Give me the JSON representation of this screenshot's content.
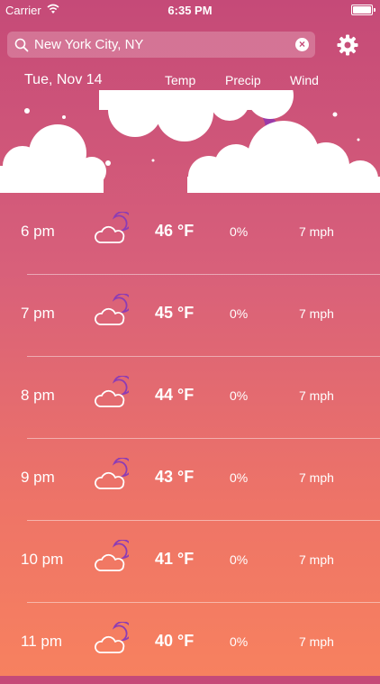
{
  "status_bar": {
    "carrier": "Carrier",
    "time": "6:35 PM"
  },
  "search": {
    "value": "New York City, NY",
    "clear_icon": "clear-icon"
  },
  "settings_icon": "gear-icon",
  "header": {
    "date": "Tue, Nov 14",
    "temp_label": "Temp",
    "precip_label": "Precip",
    "wind_label": "Wind"
  },
  "colors": {
    "gradient_top": "#c54a78",
    "gradient_bottom": "#f7815f",
    "moon": "#9b3aa8",
    "cloud": "#ffffff"
  },
  "hours": [
    {
      "time": "6 pm",
      "icon": "cloudy-night-icon",
      "temp": "46 °F",
      "precip": "0%",
      "wind": "7 mph"
    },
    {
      "time": "7 pm",
      "icon": "cloudy-night-icon",
      "temp": "45 °F",
      "precip": "0%",
      "wind": "7 mph"
    },
    {
      "time": "8 pm",
      "icon": "cloudy-night-icon",
      "temp": "44 °F",
      "precip": "0%",
      "wind": "7 mph"
    },
    {
      "time": "9 pm",
      "icon": "cloudy-night-icon",
      "temp": "43 °F",
      "precip": "0%",
      "wind": "7 mph"
    },
    {
      "time": "10 pm",
      "icon": "cloudy-night-icon",
      "temp": "41 °F",
      "precip": "0%",
      "wind": "7 mph"
    },
    {
      "time": "11 pm",
      "icon": "cloudy-night-icon",
      "temp": "40 °F",
      "precip": "0%",
      "wind": "7 mph"
    }
  ]
}
